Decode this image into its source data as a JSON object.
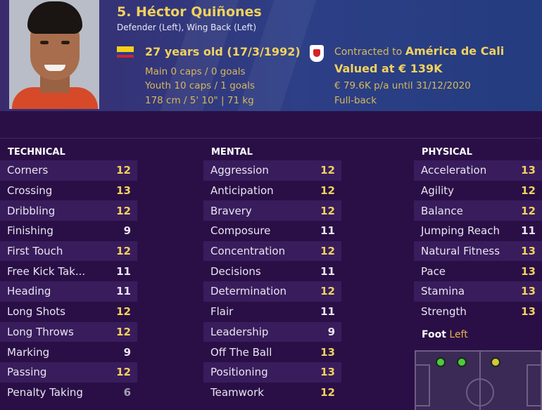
{
  "player": {
    "name": "5. Héctor Quiñones",
    "positions": "Defender (Left), Wing Back (Left)",
    "age": "27 years old (17/3/1992)",
    "main_caps": "Main 0 caps / 0 goals",
    "youth_caps": "Youth 10 caps / 1 goals",
    "body": "178 cm / 5' 10\" | 71 kg"
  },
  "contract": {
    "prefix": "Contracted to",
    "club": "América de Cali",
    "valued": "Valued at € 139K",
    "wage": "€ 79.6K p/a until 31/12/2020",
    "role": "Full-back"
  },
  "technical": {
    "title": "TECHNICAL",
    "items": [
      {
        "label": "Corners",
        "value": "12"
      },
      {
        "label": "Crossing",
        "value": "13"
      },
      {
        "label": "Dribbling",
        "value": "12"
      },
      {
        "label": "Finishing",
        "value": "9"
      },
      {
        "label": "First Touch",
        "value": "12"
      },
      {
        "label": "Free Kick Tak...",
        "value": "11"
      },
      {
        "label": "Heading",
        "value": "11"
      },
      {
        "label": "Long Shots",
        "value": "12"
      },
      {
        "label": "Long Throws",
        "value": "12"
      },
      {
        "label": "Marking",
        "value": "9"
      },
      {
        "label": "Passing",
        "value": "12"
      },
      {
        "label": "Penalty Taking",
        "value": "6"
      }
    ]
  },
  "mental": {
    "title": "MENTAL",
    "items": [
      {
        "label": "Aggression",
        "value": "12"
      },
      {
        "label": "Anticipation",
        "value": "12"
      },
      {
        "label": "Bravery",
        "value": "12"
      },
      {
        "label": "Composure",
        "value": "11"
      },
      {
        "label": "Concentration",
        "value": "12"
      },
      {
        "label": "Decisions",
        "value": "11"
      },
      {
        "label": "Determination",
        "value": "12"
      },
      {
        "label": "Flair",
        "value": "11"
      },
      {
        "label": "Leadership",
        "value": "9"
      },
      {
        "label": "Off The Ball",
        "value": "13"
      },
      {
        "label": "Positioning",
        "value": "13"
      },
      {
        "label": "Teamwork",
        "value": "12"
      }
    ]
  },
  "physical": {
    "title": "PHYSICAL",
    "items": [
      {
        "label": "Acceleration",
        "value": "13"
      },
      {
        "label": "Agility",
        "value": "12"
      },
      {
        "label": "Balance",
        "value": "12"
      },
      {
        "label": "Jumping Reach",
        "value": "11"
      },
      {
        "label": "Natural Fitness",
        "value": "13"
      },
      {
        "label": "Pace",
        "value": "13"
      },
      {
        "label": "Stamina",
        "value": "13"
      },
      {
        "label": "Strength",
        "value": "13"
      }
    ]
  },
  "foot": {
    "label": "Foot",
    "value": "Left"
  },
  "colors": {
    "background": "#2a0f46",
    "highlight": "#f2d25d",
    "position_natural": "#4ecb3d",
    "position_accomplished": "#d8c53a"
  }
}
